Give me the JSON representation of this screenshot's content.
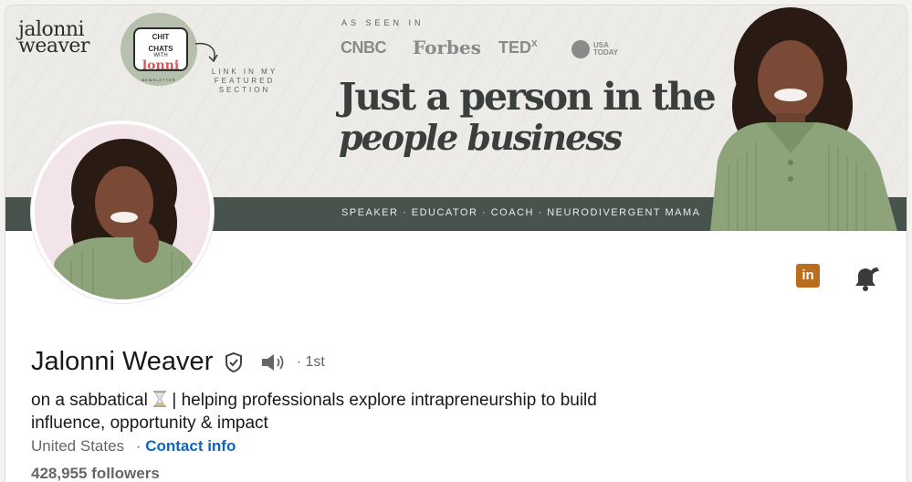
{
  "banner": {
    "logo_line1": "jalonni",
    "logo_line2": "weaver",
    "newsletter": {
      "line1": "CHIT",
      "line2": "CHATS",
      "line3": "WITH",
      "line4": "lonni",
      "tag": "NEWSLETTER"
    },
    "link_featured": "LINK IN MY FEATURED SECTION",
    "as_seen_in": "AS SEEN IN",
    "press": [
      "CNBC",
      "Forbes",
      "TED",
      "X",
      "USA",
      "TODAY"
    ],
    "headline_line1": "Just a person in the",
    "headline_line2": "people business",
    "roles": "SPEAKER · EDUCATOR · COACH · NEURODIVERGENT MAMA",
    "colors": {
      "background": "#ecebe8",
      "stripe": "#49534e",
      "text": "#3a3e3c",
      "highlight": "#f0c9cd",
      "badge": "#b7c0ad"
    }
  },
  "profile": {
    "name": "Jalonni Weaver",
    "degree": "· 1st",
    "headline_part1": "on a sabbatical",
    "headline_part2": "| helping professionals explore intrapreneurship to build influence, opportunity & impact",
    "location": "United States",
    "location_separator": "·",
    "contact_info": "Contact info",
    "followers": "428,955 followers"
  },
  "icons": {
    "verified": "verified-shield-icon",
    "speaker": "speaker-icon",
    "hourglass": "hourglass-icon",
    "linkedin": "linkedin-icon",
    "bell": "bell-icon"
  },
  "actions": {
    "linkedin_label": "in"
  },
  "colors": {
    "link": "#0a66c2",
    "linkedin_badge": "#b86e1c",
    "text_primary": "#191919",
    "text_secondary": "#666666"
  }
}
